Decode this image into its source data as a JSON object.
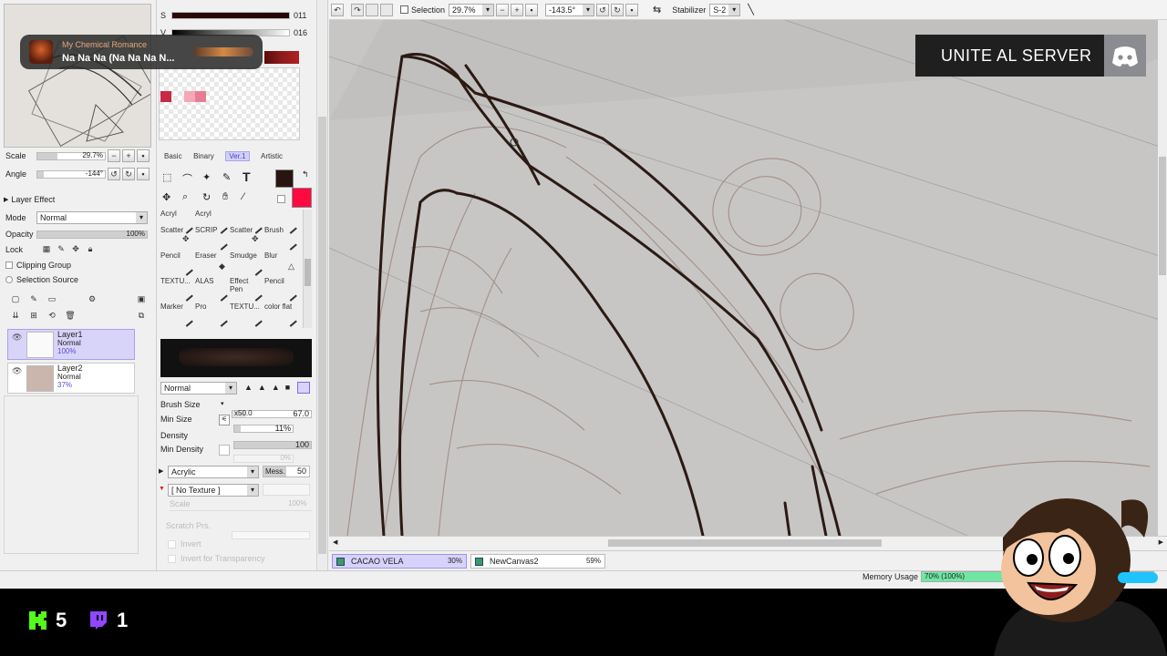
{
  "music": {
    "artist": "My Chemical Romance",
    "title": "Na Na Na (Na Na Na N..."
  },
  "discord": {
    "label": "UNITE AL SERVER",
    "icon": "discord-icon"
  },
  "counters": {
    "kick_count": "5",
    "twitch_count": "1",
    "kick_color": "#53fc18",
    "twitch_color": "#9146ff"
  },
  "color_sliders": {
    "s_label": "S",
    "s_value": "011",
    "v_label": "V",
    "v_value": "016"
  },
  "navigator": {
    "scale_label": "Scale",
    "scale_value": "29.7%",
    "angle_label": "Angle",
    "angle_value": "-144°"
  },
  "layer_panel": {
    "section": "Layer Effect",
    "mode_label": "Mode",
    "mode_value": "Normal",
    "opacity_label": "Opacity",
    "opacity_value": "100%",
    "lock_label": "Lock",
    "clipping_label": "Clipping Group",
    "selection_source_label": "Selection Source",
    "layers": [
      {
        "name": "Layer1",
        "mode": "Normal",
        "opacity": "100%"
      },
      {
        "name": "Layer2",
        "mode": "Normal",
        "opacity": "37%"
      }
    ]
  },
  "brush_tabs": [
    "Basic",
    "Binary",
    "Ver.1",
    "Artistic"
  ],
  "tools": [
    [
      "Acryl",
      "Acryl",
      ""
    ],
    [
      "Scatter",
      "SCRIP",
      "Scatter",
      "Brush"
    ],
    [
      "Pencil",
      "Eraser",
      "Smudge",
      "Blur"
    ],
    [
      "TEXTU...",
      "ALAS",
      "Effect Pen",
      "Pencil"
    ],
    [
      "Marker",
      "Pro",
      "TEXTU...",
      "color flat"
    ]
  ],
  "brush": {
    "blend_mode": "Normal",
    "size_label": "Brush Size",
    "size_mult": "x50.0",
    "size_value": "67.0",
    "min_size_label": "Min Size",
    "min_size_value": "11%",
    "density_label": "Density",
    "density_value": "100",
    "min_density_label": "Min Density",
    "min_density_value": "0%",
    "paper": "Acrylic",
    "mess_label": "Mess.",
    "mess_value": "50",
    "texture": "[ No Texture ]",
    "scale_label": "Scale",
    "scale_value": "100%",
    "scratch_label": "Scratch Prs.",
    "invert_label": "Invert",
    "invert_transparency_label": "Invert for Transparency"
  },
  "toolbar": {
    "selection_label": "Selection",
    "zoom": "29.7%",
    "rotation": "-143.5°",
    "stabilizer_label": "Stabilizer",
    "stabilizer_value": "S-2"
  },
  "documents": [
    {
      "name": "CACAO VELA",
      "pct": "30%"
    },
    {
      "name": "NewCanvas2",
      "pct": "59%"
    }
  ],
  "memory": {
    "label": "Memory Usage",
    "value": "70% (100%)"
  }
}
